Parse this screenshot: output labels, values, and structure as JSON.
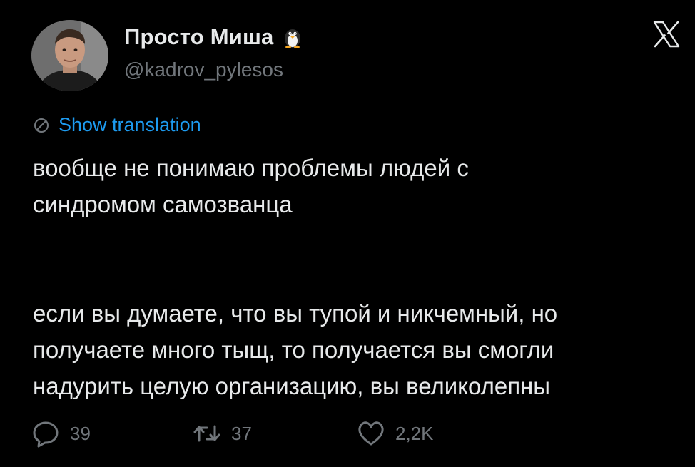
{
  "author": {
    "display_name": "Просто Миша",
    "handle": "@kadrov_pylesos",
    "badge_icon": "penguin-emoji-icon"
  },
  "platform_logo": "x-logo-icon",
  "translate": {
    "label": "Show translation",
    "icon": "globe-icon",
    "color": "#1d9bf0"
  },
  "tweet": {
    "text": "вообще не понимаю проблемы людей с\nсиндромом самозванца\n\n\nесли вы думаете, что вы тупой и никчемный, но\nполучаете много тыщ, то получается вы смогли\nнадурить целую организацию, вы великолепны"
  },
  "actions": {
    "replies": "39",
    "retweets": "37",
    "likes": "2,2K"
  },
  "colors": {
    "background": "#000000",
    "text": "#e7e9ea",
    "muted": "#71767b",
    "accent": "#1d9bf0"
  }
}
